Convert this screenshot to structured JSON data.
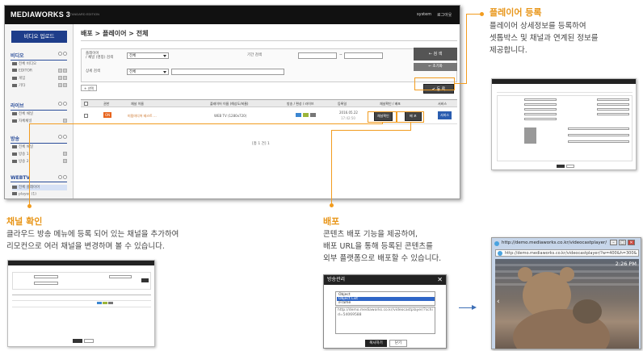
{
  "app": {
    "logo": "MEDIAWORKS 3",
    "edition": "STANDARD EDITION",
    "system_link": "system",
    "logout_link": "로그아웃"
  },
  "sidebar": {
    "upload_button": "비디오 업로드",
    "sections": [
      {
        "title": "비디오",
        "items": [
          "전체 비디오",
          "EDITOR",
          "게임",
          "기타"
        ]
      },
      {
        "title": "라이브",
        "items": [
          "전체 채널",
          "자체채널"
        ]
      },
      {
        "title": "방송",
        "items": [
          "전체 채널",
          "방송 1",
          "방송 2"
        ]
      },
      {
        "title": "WEBTV",
        "items": [
          "전체 플레이어",
          "player (1)"
        ]
      }
    ]
  },
  "content": {
    "breadcrumb": "배포 > 플레이어 > 전체",
    "search": {
      "type_label": "플레이어\n/ 채널 (명칭) 검색",
      "type_value": "전체",
      "period_label": "기간 검색",
      "detail_label": "상세 검색",
      "detail_value": "전체",
      "period_separator": "~",
      "search_button": "← 검 색",
      "reset_button": "← 초기화"
    },
    "select_button": "+ 선택",
    "register_button": "✔ 등 록",
    "table": {
      "headers": [
        "",
        "권한",
        "채널 이름",
        "플레이어 이름 (해상도/비율)",
        "방송 / 편성 / 라이브",
        "등록일",
        "채널확인 / 배포",
        "서비스"
      ],
      "row": {
        "badge": "ON",
        "channel": "미림미디어 테스트 ...",
        "player": "WEB TV (1280x720)",
        "date": "2016.05.22",
        "time": "17:42:50",
        "confirm_button": "채널확인",
        "deploy_button": "배 포",
        "service_button": "서비스"
      }
    },
    "paging": "[총 1 건] 1"
  },
  "callouts": {
    "player_register": {
      "title": "플레이어 등록",
      "desc": [
        "플레이어 상세정보를 등록하여",
        "셋톱박스 및 채널과 연계된 정보를",
        "제공합니다."
      ]
    },
    "channel_confirm": {
      "title": "채널 확인",
      "desc": [
        "클라우드 방송 메뉴에 등록 되어 있는 채널을 추가하여",
        "리모컨으로 여러 채널을 변경하며 볼 수 있습니다."
      ]
    },
    "deploy": {
      "title": "배포",
      "desc": [
        "콘텐츠 배포 기능을 제공하여,",
        "배포 URL을 통해 등록된 콘텐츠를",
        "외부 플랫폼으로 배포할 수 있습니다."
      ]
    }
  },
  "dialog": {
    "title": "방송관리",
    "options": [
      "Object",
      "Object List",
      "iFrame"
    ],
    "selected_option": 1,
    "url_text": "http://demo.mediaworks.co.kr/videocastplayer/?schid=54069588",
    "copy_button": "복사하기",
    "close_button": "닫기"
  },
  "browser": {
    "title": "http://demo.mediaworks.co.kr/videocastplayer/?w=400&h=300&",
    "url": "http://demo.mediaworks.co.kr/videocastplayer/?w=400&h=300&",
    "video_time": "2:26 PM"
  },
  "colors": {
    "accent_orange": "#f29c1f",
    "nav_blue": "#1e3d8a",
    "arrow_blue": "#3d6fb6"
  }
}
